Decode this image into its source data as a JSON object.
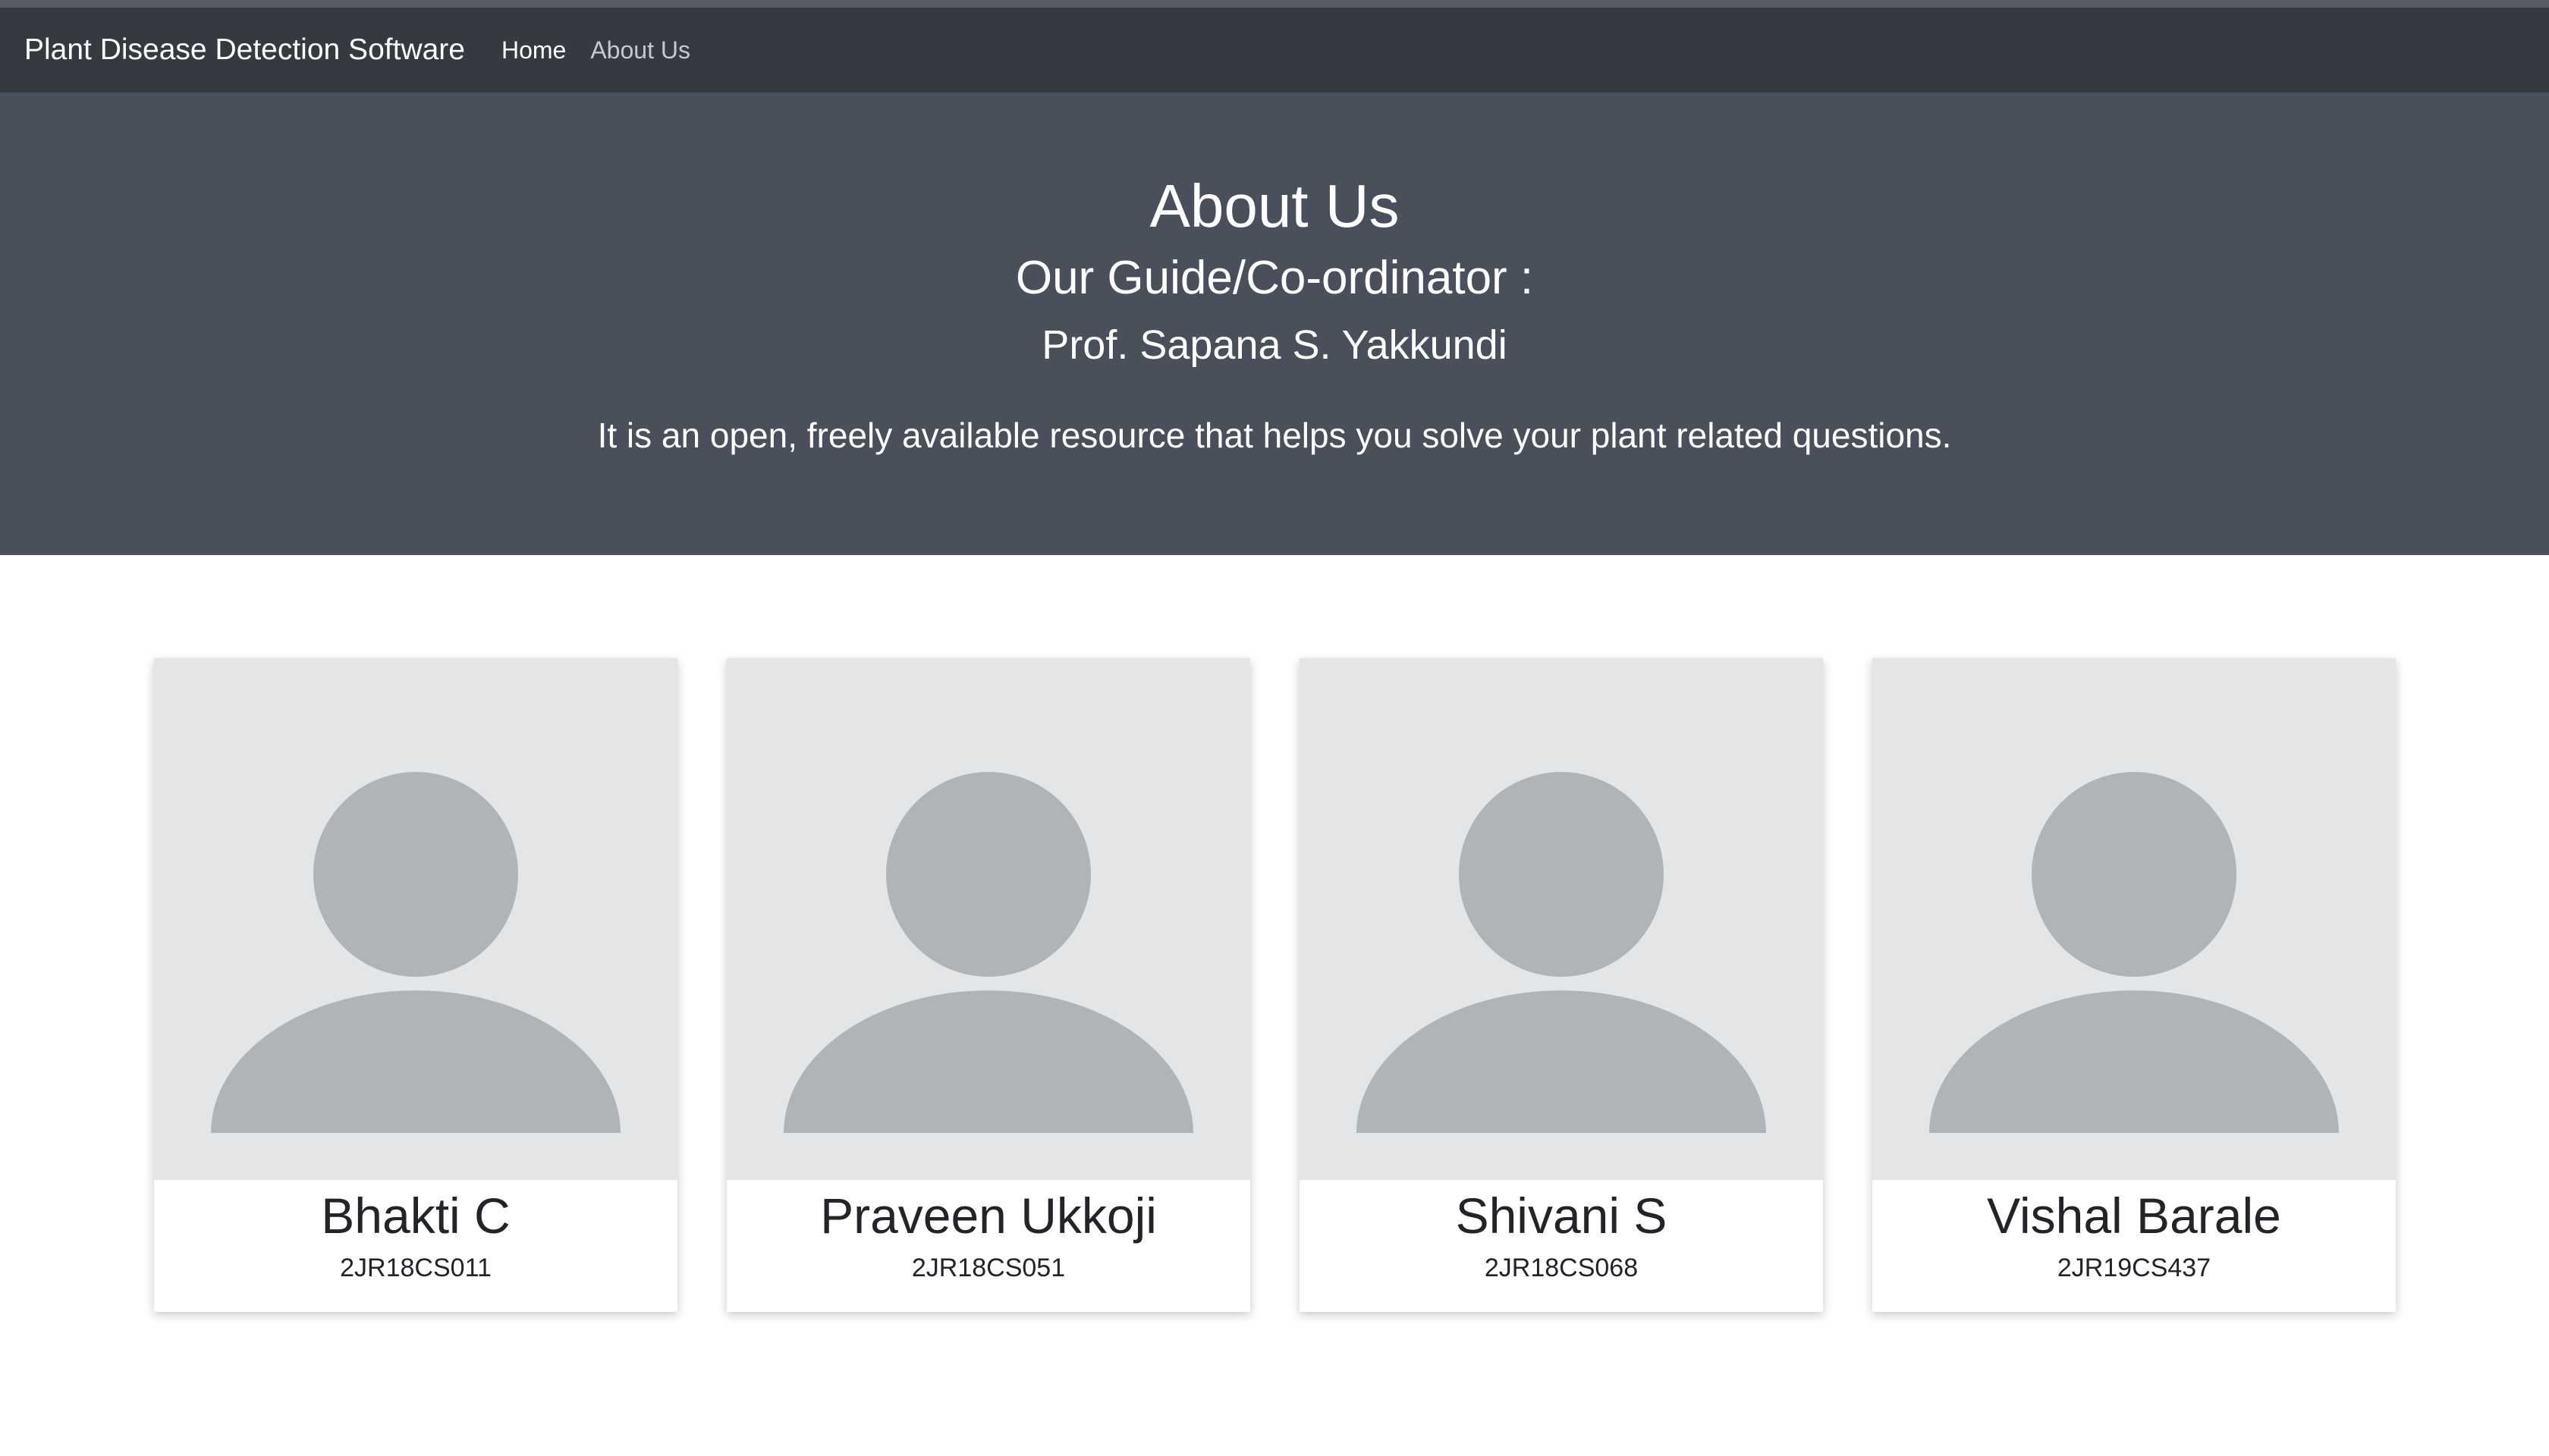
{
  "navbar": {
    "brand": "Plant Disease Detection Software",
    "links": [
      {
        "label": "Home"
      },
      {
        "label": "About Us"
      }
    ]
  },
  "hero": {
    "title": "About Us",
    "guide_heading": "Our Guide/Co-ordinator :",
    "guide_name": "Prof. Sapana S. Yakkundi",
    "description": "It is an open, freely available resource that helps you solve your plant related questions."
  },
  "team": [
    {
      "name": "Bhakti C",
      "id": "2JR18CS011",
      "avatar": "user-placeholder-icon"
    },
    {
      "name": "Praveen Ukkoji",
      "id": "2JR18CS051",
      "avatar": "user-placeholder-icon"
    },
    {
      "name": "Shivani S",
      "id": "2JR18CS068",
      "avatar": "user-placeholder-icon"
    },
    {
      "name": "Vishal Barale",
      "id": "2JR19CS437",
      "avatar": "user-placeholder-icon"
    }
  ],
  "colors": {
    "navbar_bg": "#343a40",
    "hero_bg": "#4a4f5c",
    "avatar_bg": "#e4e5e7",
    "avatar_fg": "#afb4b6"
  }
}
